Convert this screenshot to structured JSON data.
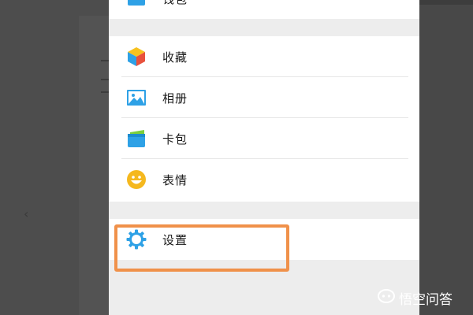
{
  "menu": {
    "top_item": {
      "label": "钱包",
      "icon": "wallet-icon"
    },
    "items": [
      {
        "label": "收藏",
        "icon": "favorites-cube-icon"
      },
      {
        "label": "相册",
        "icon": "album-picture-icon"
      },
      {
        "label": "卡包",
        "icon": "card-wallet-icon"
      },
      {
        "label": "表情",
        "icon": "smiley-face-icon"
      }
    ],
    "settings": {
      "label": "设置",
      "icon": "gear-icon"
    }
  },
  "watermark": {
    "text": "悟空问答",
    "icon": "wukong-logo-icon"
  },
  "colors": {
    "highlight": "#f0914a",
    "icon_blue": "#2ea1e6",
    "smiley_yellow": "#f5b81e",
    "panel_bg": "#ededed",
    "overlay_bg": "#4b4b4b"
  }
}
